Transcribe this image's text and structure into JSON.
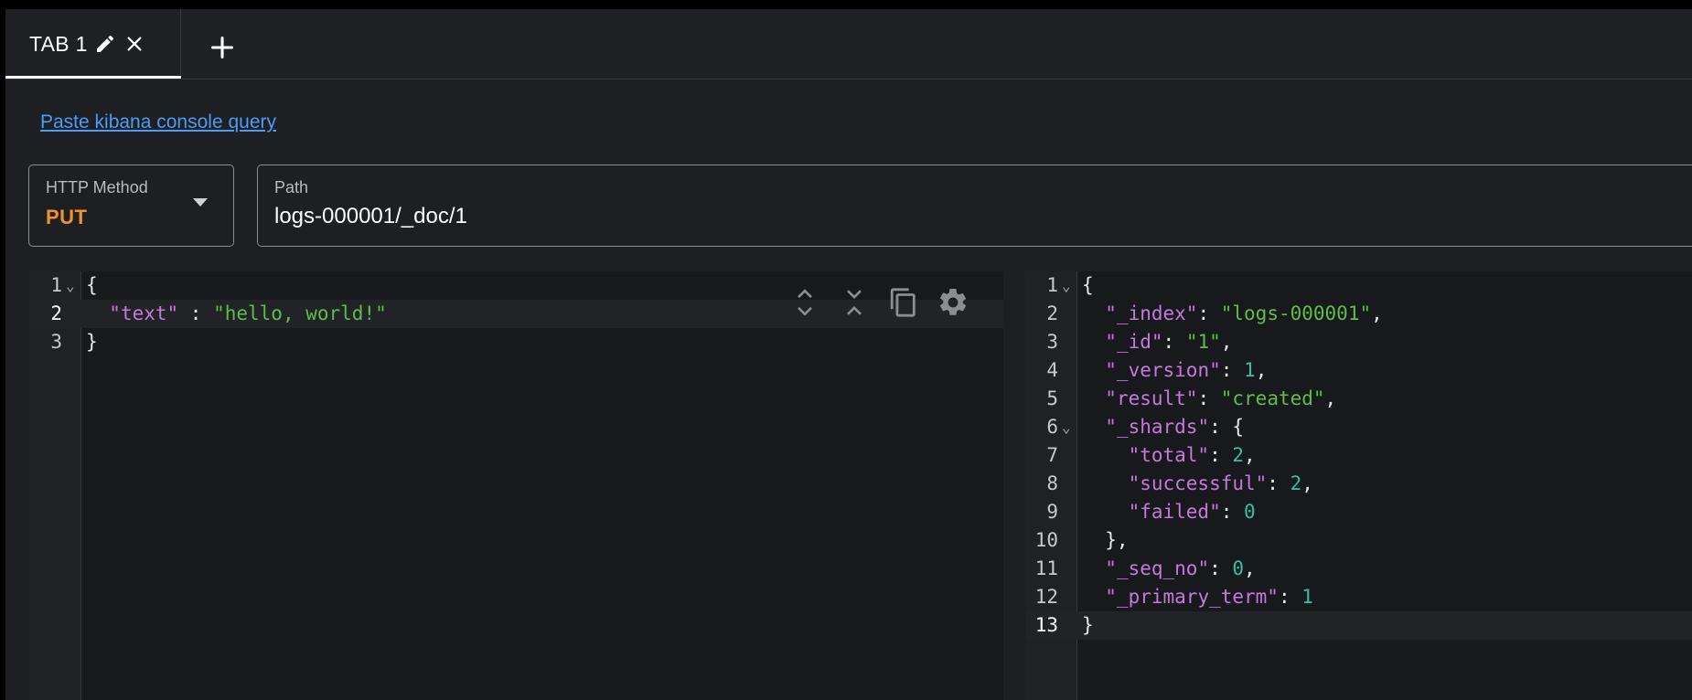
{
  "tabs": [
    {
      "label": "TAB 1"
    }
  ],
  "link": {
    "kibana": "Paste kibana console query"
  },
  "method": {
    "label": "HTTP Method",
    "value": "PUT"
  },
  "path": {
    "label": "Path",
    "value": "logs-000001/_doc/1"
  },
  "request": {
    "lines": [
      {
        "num": "1",
        "code": "{"
      },
      {
        "num": "2",
        "code": "  \"text\" : \"hello, world!\""
      },
      {
        "num": "3",
        "code": "}"
      }
    ]
  },
  "response": {
    "lines": [
      {
        "num": "1",
        "code": "{"
      },
      {
        "num": "2",
        "code": "  \"_index\": \"logs-000001\","
      },
      {
        "num": "3",
        "code": "  \"_id\": \"1\","
      },
      {
        "num": "4",
        "code": "  \"_version\": 1,"
      },
      {
        "num": "5",
        "code": "  \"result\": \"created\","
      },
      {
        "num": "6",
        "code": "  \"_shards\": {"
      },
      {
        "num": "7",
        "code": "    \"total\": 2,"
      },
      {
        "num": "8",
        "code": "    \"successful\": 2,"
      },
      {
        "num": "9",
        "code": "    \"failed\": 0"
      },
      {
        "num": "10",
        "code": "  },"
      },
      {
        "num": "11",
        "code": "  \"_seq_no\": 0,"
      },
      {
        "num": "12",
        "code": "  \"_primary_term\": 1"
      },
      {
        "num": "13",
        "code": "}"
      }
    ]
  },
  "icons": {
    "tab_edit": "pencil-icon",
    "tab_close": "close-icon",
    "add_tab": "plus-icon",
    "expand": "unfold-more-icon",
    "collapse": "unfold-less-icon",
    "copy": "copy-icon",
    "settings": "gear-icon"
  },
  "colors": {
    "method": "#f0922b",
    "link": "#4a9cf5",
    "json_key": "#c678dd",
    "json_string": "#5dbf47",
    "json_number": "#33c1a4"
  }
}
